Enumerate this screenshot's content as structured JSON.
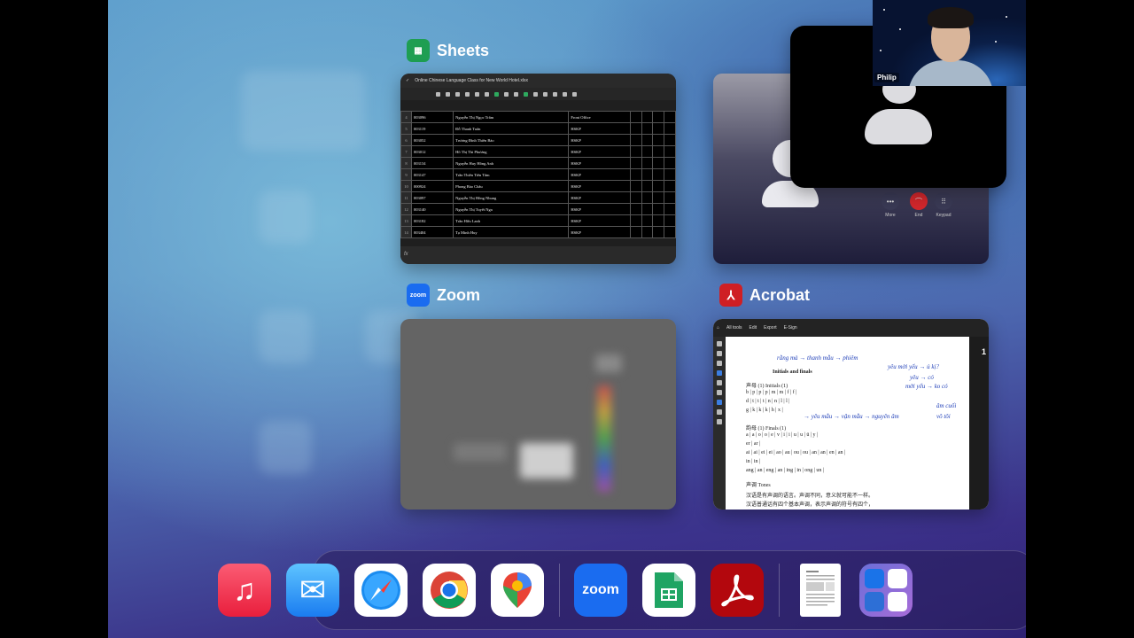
{
  "apps": {
    "sheets": {
      "label": "Sheets",
      "color": "#1e9e52"
    },
    "zoom": {
      "label": "Zoom",
      "color": "#1a6cf0"
    },
    "acrobat": {
      "label": "Acrobat",
      "color": "#cf1f24"
    }
  },
  "sheets_window": {
    "file_title": "Online Chinese Language Class for New World Hotel.xlsx",
    "rows": [
      {
        "n": "4",
        "id": "003096",
        "name": "Nguyễn Thị Ngọc Trâm",
        "dept": "Front Office"
      },
      {
        "n": "5",
        "id": "003119",
        "name": "Đỗ Thanh Tuấn",
        "dept": "HSKP"
      },
      {
        "n": "6",
        "id": "003052",
        "name": "Trương Đình Thiên Bảo",
        "dept": "HSKP"
      },
      {
        "n": "7",
        "id": "003012",
        "name": "Hồ Thị Thi Phương",
        "dept": "HSKP"
      },
      {
        "n": "8",
        "id": "003134",
        "name": "Nguyễn Huy Hồng Anh",
        "dept": "HSKP"
      },
      {
        "n": "9",
        "id": "003147",
        "name": "Trần Thiên Tiến Tâm",
        "dept": "HSKP"
      },
      {
        "n": "10",
        "id": "000924",
        "name": "Phong Bảo Châu",
        "dept": "HSKP"
      },
      {
        "n": "11",
        "id": "003097",
        "name": "Nguyễn Thị Hồng Nhung",
        "dept": "HSKP"
      },
      {
        "n": "12",
        "id": "003140",
        "name": "Nguyễn Thị Tuyết Nga",
        "dept": "HSKP"
      },
      {
        "n": "13",
        "id": "003182",
        "name": "Trần Hữu Lanh",
        "dept": "HSKP"
      },
      {
        "n": "14",
        "id": "003404",
        "name": "Tạ Minh Huy",
        "dept": "HSKP"
      }
    ],
    "formula_prefix": "fx"
  },
  "call_window": {
    "buttons": [
      {
        "label": "More",
        "glyph": "•••"
      },
      {
        "label": "End",
        "glyph": "⌒"
      },
      {
        "label": "Keypad",
        "glyph": "⠿"
      }
    ]
  },
  "pip": {
    "participant_name": "Philip"
  },
  "acrobat_window": {
    "menu": [
      "All tools",
      "Edit",
      "Export",
      "E-Sign"
    ],
    "page_number": "1",
    "lines": [
      "Initials and finals",
      "声母 (1)   Initials (1)",
      "b | p |      p | p |      m | m |      f | f |",
      "d | t |      t | t |      n | n |      l | l |",
      "g | k |      k | k |      h | x |",
      "韵母 (1)   Finals (1)",
      "a | a |      o | o |      e | v |      i | i |      u | u |      ü | y |",
      "er | ar |",
      "ai | ai |      ei | ei |      ao | au |      ou | ou |      an | an |      en | an |",
      "in | in |",
      "ang | an |      eng | an |      ing | in |      ong | un |",
      "声调   Tones",
      "汉语是有声调的语言。声调不同，意义就可能不一样。",
      "汉语普通话有四个基本声调，表示声调的符号有四个，"
    ],
    "handwriting": [
      "rằng mà → thanh mẫu → phiêm",
      "yêu mời yểu → ủ kị?",
      "yêu → có",
      "mời yểu → ko có",
      "→ yêu mẫu → vận mẫu → nguyên âm",
      "âm cuối",
      "vô tôi"
    ]
  },
  "dock": {
    "items": [
      {
        "name": "music",
        "glyph": "♫"
      },
      {
        "name": "mail",
        "glyph": "✉"
      },
      {
        "name": "safari",
        "glyph": ""
      },
      {
        "name": "chrome",
        "glyph": ""
      },
      {
        "name": "maps",
        "glyph": ""
      },
      {
        "name": "zoom",
        "glyph": "zoom"
      },
      {
        "name": "sheets",
        "glyph": ""
      },
      {
        "name": "acrobat",
        "glyph": ""
      },
      {
        "name": "recent-document",
        "glyph": ""
      },
      {
        "name": "app-library",
        "glyph": ""
      }
    ]
  }
}
